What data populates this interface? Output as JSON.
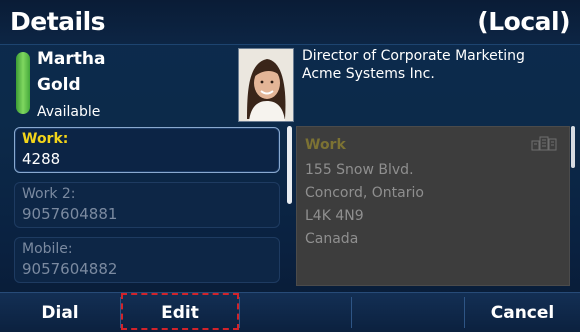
{
  "header": {
    "title": "Details",
    "scope": "(Local)"
  },
  "contact": {
    "first_name": "Martha",
    "last_name": "Gold",
    "status": "Available",
    "job_title": "Director of Corporate Marketing",
    "company": "Acme Systems Inc."
  },
  "numbers": [
    {
      "label": "Work:",
      "value": "4288"
    },
    {
      "label": "Work 2:",
      "value": "9057604881"
    },
    {
      "label": "Mobile:",
      "value": "9057604882"
    }
  ],
  "address": {
    "label": "Work",
    "lines": [
      "155 Snow Blvd.",
      "Concord, Ontario",
      "L4K 4N9",
      "Canada"
    ],
    "icon": "building-icon"
  },
  "softkeys": {
    "dial": "Dial",
    "edit": "Edit",
    "cancel": "Cancel"
  },
  "colors": {
    "presence": "#5cc24a",
    "selected_label": "#f3d41a",
    "highlight": "#d2232a"
  }
}
